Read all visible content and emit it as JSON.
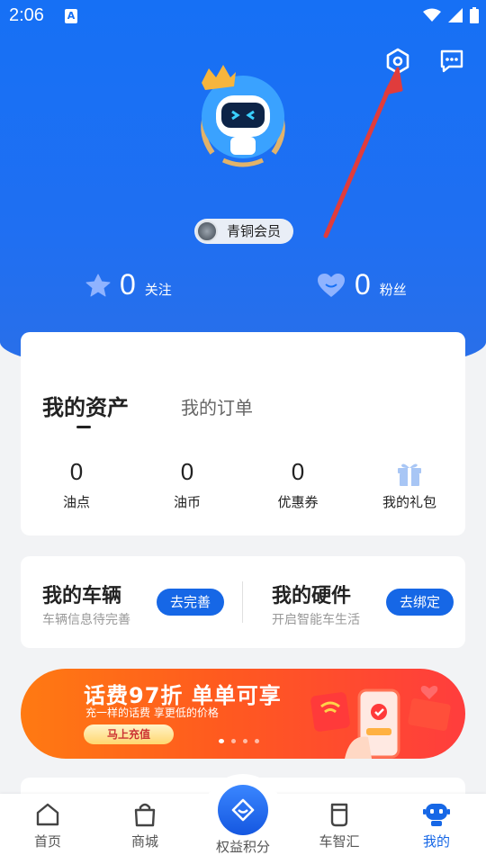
{
  "status_bar": {
    "time": "2:06",
    "notif_letter": "A"
  },
  "header": {
    "settings_icon": "settings-hexagon-icon",
    "messages_icon": "chat-bubble-icon",
    "membership": "青铜会员",
    "stats": [
      {
        "value": "0",
        "label": "关注"
      },
      {
        "value": "0",
        "label": "粉丝"
      }
    ]
  },
  "assets": {
    "tabs": [
      {
        "label": "我的资产",
        "active": true
      },
      {
        "label": "我的订单",
        "active": false
      }
    ],
    "items": [
      {
        "value": "0",
        "label": "油点"
      },
      {
        "value": "0",
        "label": "油币"
      },
      {
        "value": "0",
        "label": "优惠券"
      },
      {
        "value": "",
        "label": "我的礼包",
        "icon": "gift-icon"
      }
    ]
  },
  "vehicle": {
    "car": {
      "title": "我的车辆",
      "subtitle": "车辆信息待完善",
      "button": "去完善"
    },
    "hardware": {
      "title": "我的硬件",
      "subtitle": "开启智能车生活",
      "button": "去绑定"
    }
  },
  "banner": {
    "headline": "话费97折 单单可享",
    "subline": "充一样的话费 享更低的价格",
    "cta": "马上充值",
    "slide_count": 4,
    "active_slide": 1
  },
  "tabbar": {
    "items": [
      {
        "label": "首页",
        "icon": "home-icon",
        "active": false
      },
      {
        "label": "商城",
        "icon": "shopping-bag-icon",
        "active": false
      },
      {
        "label": "权益积分",
        "icon": "diamond-icon",
        "active": false
      },
      {
        "label": "车智汇",
        "icon": "cup-icon",
        "active": false
      },
      {
        "label": "我的",
        "icon": "robot-icon",
        "active": true
      }
    ]
  },
  "colors": {
    "primary": "#1667e6",
    "hero": "#1670f5",
    "banner": "#ff5a1f",
    "arrow": "#e03c3c"
  }
}
